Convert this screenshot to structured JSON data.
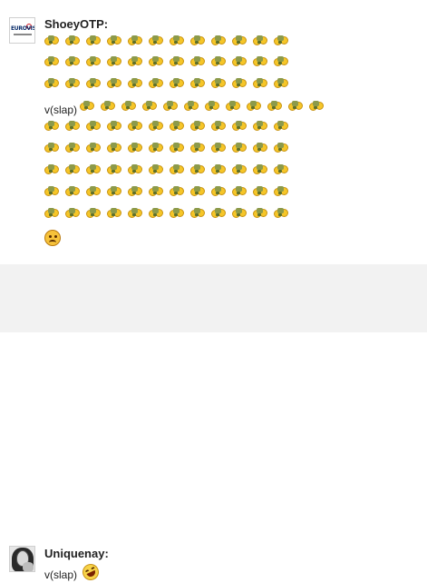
{
  "messages": [
    {
      "author": "ShoeyOTP:",
      "avatar_icon": "eurovision-logo-avatar",
      "rows": [
        {
          "prefix": "",
          "count": 12
        },
        {
          "prefix": "",
          "count": 12
        },
        {
          "prefix": "",
          "count": 12
        },
        {
          "prefix": "v(slap)",
          "count": 12
        },
        {
          "prefix": "",
          "count": 12
        },
        {
          "prefix": "",
          "count": 12
        },
        {
          "prefix": "",
          "count": 12
        },
        {
          "prefix": "",
          "count": 12
        },
        {
          "prefix": "",
          "count": 12
        }
      ],
      "repeated_icon": "slap-emoticon-icon",
      "final_icon": "sad-face-icon"
    },
    {
      "author": "Uniquenay:",
      "avatar_icon": "user-photo-avatar",
      "text": "v(slap)",
      "final_icon": "laughing-face-icon"
    }
  ],
  "colors": {
    "alt_background": "#f2f2f2",
    "emoticon_yellow": "#f6c628"
  }
}
